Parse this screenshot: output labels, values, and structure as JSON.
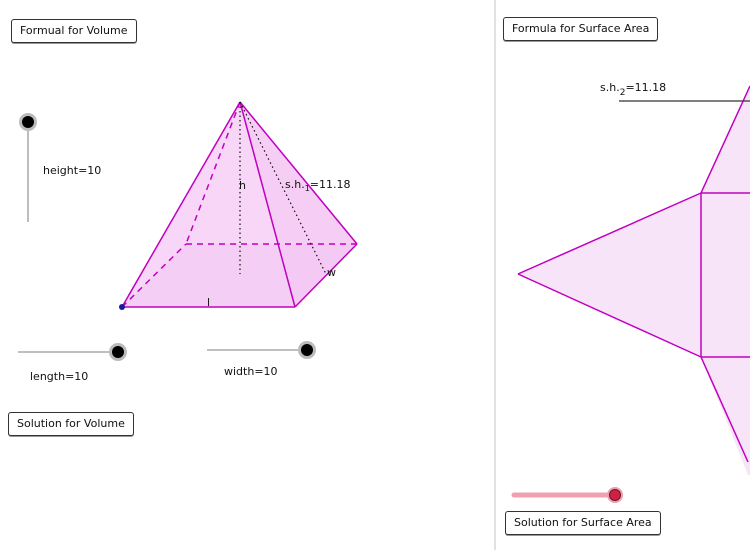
{
  "left": {
    "buttons": {
      "volume_formula": "Formual for Volume",
      "volume_solution": "Solution for Volume"
    },
    "sliders": {
      "height": "height=10",
      "length": "length=10",
      "width": "width=10"
    },
    "pyramid_labels": {
      "h": "h",
      "slant": "s.h.",
      "slant_sub": "1",
      "slant_value": "=11.18",
      "l": "l",
      "w": "w"
    }
  },
  "right": {
    "buttons": {
      "surface_formula": "Formula for Surface Area",
      "surface_solution": "Solution for Surface Area"
    },
    "net_label": {
      "prefix": "s.h.",
      "sub": "2",
      "value": "=11.18"
    }
  },
  "colors": {
    "shape_stroke": "#c000c0",
    "shape_fill": "#f4c8f4",
    "net_fill": "#f8e4f8",
    "slider_red": "#cc2244",
    "slider_track_red": "#f0a0b0"
  }
}
